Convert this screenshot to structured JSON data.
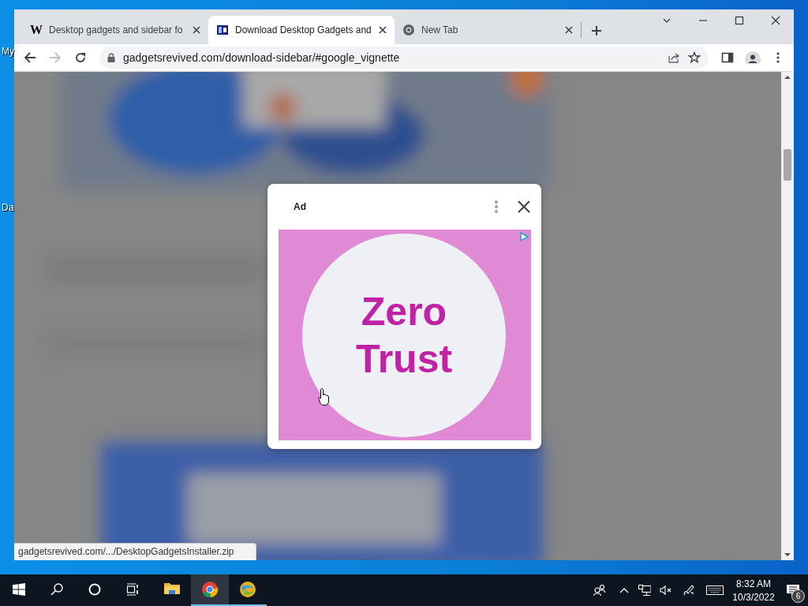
{
  "desktop_icons": [
    {
      "label": "My"
    },
    {
      "label": "Da"
    }
  ],
  "browser": {
    "tabs": [
      {
        "title": "Desktop gadgets and sidebar fo",
        "selected": false,
        "kind": "letter",
        "icon_text": "W"
      },
      {
        "title": "Download Desktop Gadgets and",
        "selected": true,
        "kind": "site"
      },
      {
        "title": "New Tab",
        "selected": false,
        "kind": "chrome"
      }
    ],
    "nav": {
      "back_disabled": false,
      "forward_disabled": true
    },
    "address": "gadgetsrevived.com/download-sidebar/#google_vignette",
    "ad": {
      "label": "Ad",
      "headline": "Zero Trust"
    },
    "status_url": "gadgetsrevived.com/.../DesktopGadgetsInstaller.zip"
  },
  "taskbar": {
    "apps": [
      {
        "kind": "explorer",
        "selected": false,
        "running": false
      },
      {
        "kind": "chrome",
        "selected": true,
        "running": true
      },
      {
        "kind": "app",
        "selected": false,
        "running": true
      }
    ],
    "volume_muted": true,
    "time": "8:32 AM",
    "date": "10/3/2022",
    "notification_count": "6"
  }
}
